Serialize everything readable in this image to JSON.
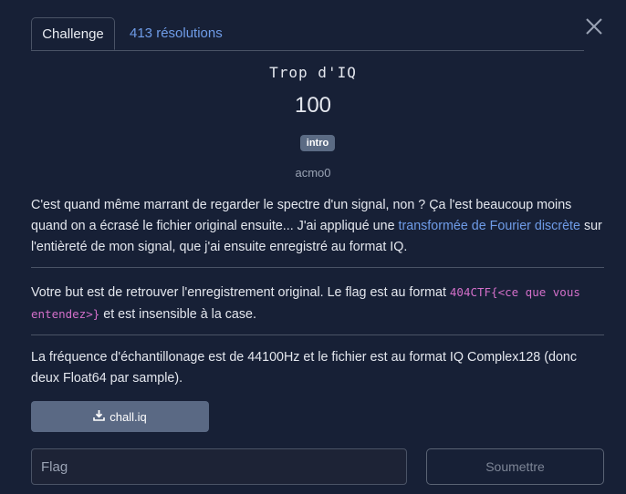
{
  "tabs": [
    {
      "label": "Challenge",
      "active": true
    },
    {
      "label": "413 résolutions",
      "active": false
    }
  ],
  "challenge": {
    "title": "Trop d'IQ",
    "value": "100",
    "tag": "intro",
    "author": "acmo0"
  },
  "description": {
    "p1_a": "C'est quand même marrant de regarder le spectre d'un signal, non ? Ça l'est beaucoup moins quand on a écrasé le fichier original ensuite... J'ai appliqué une ",
    "p1_link": "transformée de Fourier discrète",
    "p1_b": " sur l'entièreté de mon signal, que j'ai ensuite enregistré au format IQ.",
    "p2_a": "Votre but est de retrouver l'enregistrement original. Le flag est au format ",
    "p2_code": "404CTF{<ce que vous entendez>}",
    "p2_b": " et est insensible à la case.",
    "p3": "La fréquence d'échantillonage est de 44100Hz et le fichier est au format IQ Complex128 (donc deux Float64 par sample)."
  },
  "file": {
    "label": "chall.iq",
    "icon": "download-icon"
  },
  "form": {
    "flag_placeholder": "Flag",
    "submit_label": "Soumettre"
  },
  "colors": {
    "background": "#172036",
    "link": "#6f9ce8",
    "code": "#d36fc9",
    "button": "#5a6984"
  }
}
